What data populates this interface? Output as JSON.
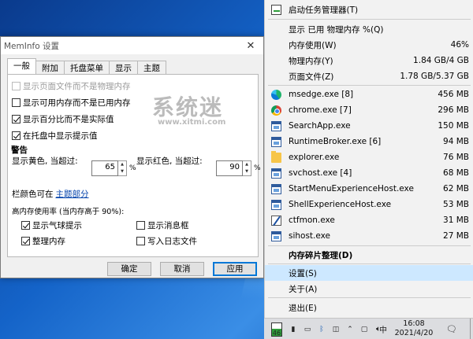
{
  "dialog": {
    "title": "MemInfo 设置",
    "close_glyph": "✕",
    "tabs": [
      "一般",
      "附加",
      "托盘菜单",
      "显示",
      "主题"
    ],
    "options": [
      {
        "label": "显示页面文件而不是物理内存",
        "checked": false,
        "disabled": true
      },
      {
        "label": "显示可用内存而不是已用内存",
        "checked": false,
        "disabled": false
      },
      {
        "label": "显示百分比而不是实际值",
        "checked": true,
        "disabled": false
      },
      {
        "label": "在托盘中显示提示值",
        "checked": true,
        "disabled": false
      }
    ],
    "warning_heading": "警告",
    "yellow_label": "显示黄色, 当超过:",
    "yellow_value": "65",
    "red_label": "显示红色, 当超过:",
    "red_value": "90",
    "percent": "%",
    "bar_color_prefix": "栏颜色可在",
    "bar_color_link": "主题部分",
    "high_usage_heading": "高内存使用率 (当内存高于 90%):",
    "high_usage_options": [
      {
        "label": "显示气球提示",
        "checked": true
      },
      {
        "label": "显示消息框",
        "checked": false
      },
      {
        "label": "整理内存",
        "checked": true
      },
      {
        "label": "写入日志文件",
        "checked": false
      }
    ],
    "buttons": {
      "ok": "确定",
      "cancel": "取消",
      "apply": "应用"
    }
  },
  "menu": {
    "task_manager": "启动任务管理器(T)",
    "display_header": "显示  已用 物理内存 %(Q)",
    "stats": [
      {
        "label": "内存使用(W)",
        "value": "46%"
      },
      {
        "label": "物理内存(Y)",
        "value": "1.84 GB/4 GB"
      },
      {
        "label": "页面文件(Z)",
        "value": "1.78 GB/5.37 GB"
      }
    ],
    "processes": [
      {
        "name": "msedge.exe [8]",
        "mem": "456 MB",
        "icon": "edge-icon"
      },
      {
        "name": "chrome.exe [7]",
        "mem": "296 MB",
        "icon": "chrome-icon"
      },
      {
        "name": "SearchApp.exe",
        "mem": "150 MB",
        "icon": "window-icon"
      },
      {
        "name": "RuntimeBroker.exe [6]",
        "mem": "94 MB",
        "icon": "window-icon"
      },
      {
        "name": "explorer.exe",
        "mem": "76 MB",
        "icon": "folder-icon"
      },
      {
        "name": "svchost.exe [4]",
        "mem": "68 MB",
        "icon": "window-icon"
      },
      {
        "name": "StartMenuExperienceHost.exe",
        "mem": "62 MB",
        "icon": "window-icon"
      },
      {
        "name": "ShellExperienceHost.exe",
        "mem": "53 MB",
        "icon": "window-icon"
      },
      {
        "name": "ctfmon.exe",
        "mem": "31 MB",
        "icon": "pen-icon"
      },
      {
        "name": "sihost.exe",
        "mem": "27 MB",
        "icon": "window-icon"
      }
    ],
    "defrag": "内存碎片整理(D)",
    "settings": "设置(S)",
    "about": "关于(A)",
    "exit": "退出(E)"
  },
  "taskbar": {
    "tray_badge": "46",
    "ime": "中",
    "time": "16:08",
    "date": "2021/4/20"
  },
  "watermark": {
    "main": "系统迷",
    "sub": "www.xitmi.com"
  }
}
